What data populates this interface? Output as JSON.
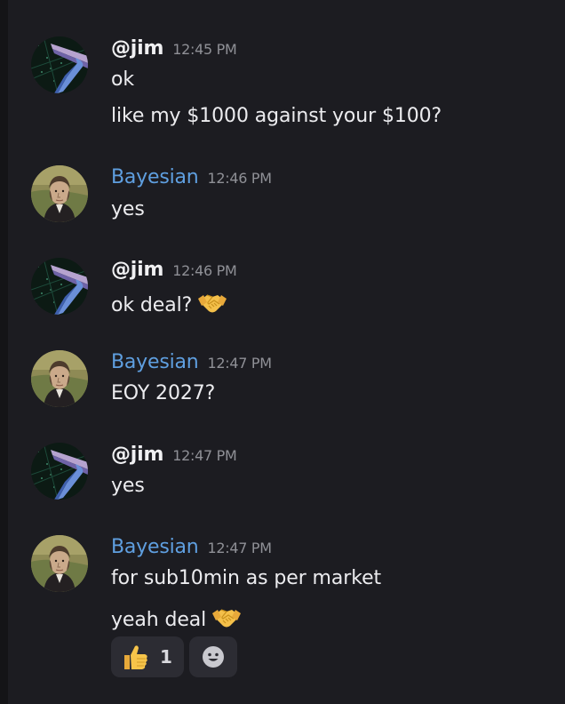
{
  "users": {
    "jim": {
      "name": "@jim",
      "avatar_icon": "jim-avatar-image"
    },
    "bayesian": {
      "name": "Bayesian",
      "avatar_icon": "bayesian-portrait-avatar",
      "color": "#5f9fe0"
    }
  },
  "messages": [
    {
      "author": "@jim",
      "time": "12:45 PM",
      "lines": [
        "ok",
        "like my $1000 against your $100?"
      ]
    },
    {
      "author": "Bayesian",
      "time": "12:46 PM",
      "lines": [
        "yes"
      ]
    },
    {
      "author": "@jim",
      "time": "12:46 PM",
      "lines": [
        "ok deal?"
      ],
      "emoji": "handshake-icon"
    },
    {
      "author": "Bayesian",
      "time": "12:47 PM",
      "lines": [
        "EOY 2027?"
      ]
    },
    {
      "author": "@jim",
      "time": "12:47 PM",
      "lines": [
        "yes"
      ]
    },
    {
      "author": "Bayesian",
      "time": "12:47 PM",
      "lines": [
        "for sub10min as per market",
        "yeah deal"
      ],
      "emoji": "handshake-icon"
    }
  ],
  "reactions": [
    {
      "icon": "thumbs-up-icon",
      "count": "1"
    },
    {
      "icon": "add-reaction-icon"
    }
  ],
  "colors": {
    "background": "#1c1c21",
    "rail": "#141417",
    "bayesian_name": "#5f9fe0",
    "timestamp": "#8f9096",
    "reaction_bg": "#2c2c33"
  }
}
